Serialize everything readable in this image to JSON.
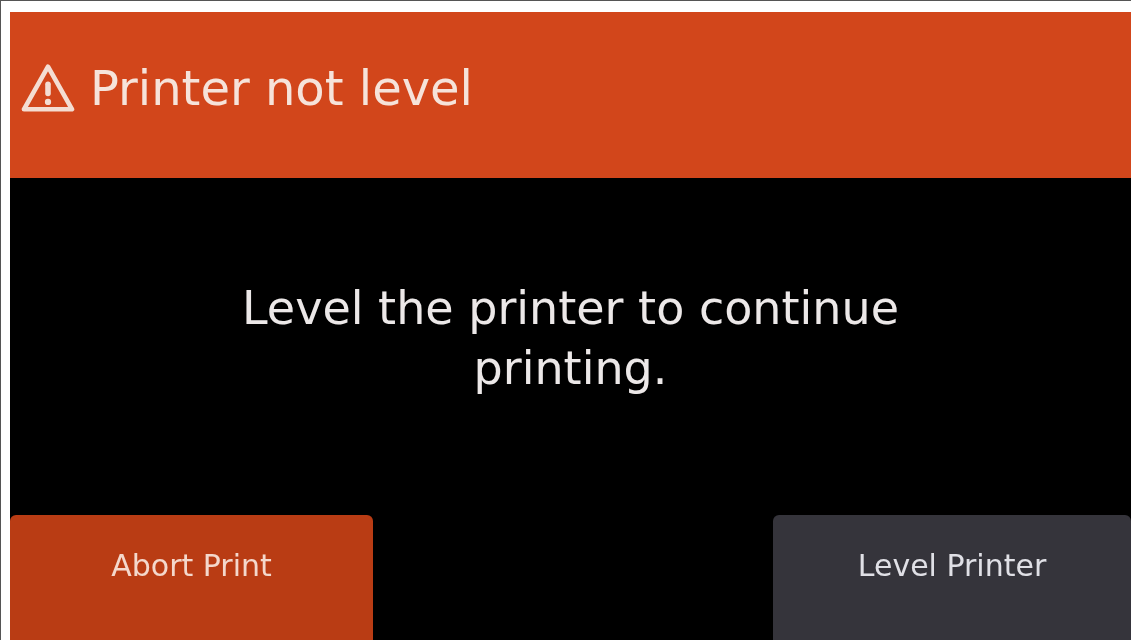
{
  "header": {
    "title": "Printer not level"
  },
  "message": "Level the printer to continue printing.",
  "buttons": [
    {
      "label": "Abort Print",
      "kind": "primary"
    },
    {
      "label": "Level Printer",
      "kind": "secondary"
    }
  ]
}
